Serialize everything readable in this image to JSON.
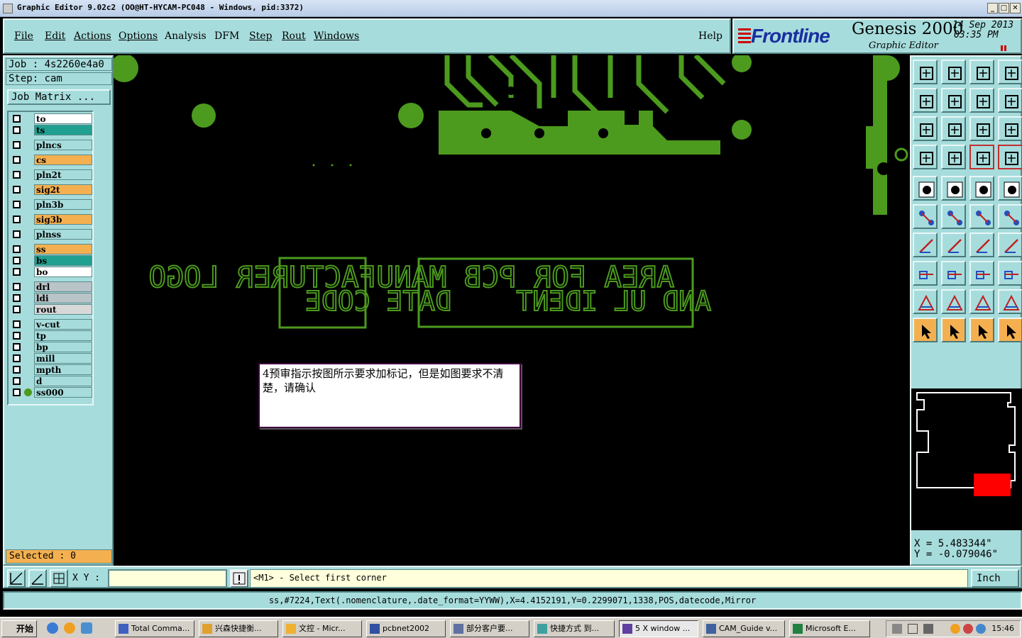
{
  "window": {
    "title": "Graphic Editor 9.02c2 (OO@HT-HYCAM-PC048 - Windows, pid:3372)"
  },
  "menu": [
    "File",
    "Edit",
    "Actions",
    "Options",
    "Analysis",
    "DFM",
    "Step",
    "Rout",
    "Windows"
  ],
  "help_label": "Help",
  "brand": {
    "logo": "Frontline",
    "product": "Genesis 2000",
    "subtitle": "Graphic Editor",
    "date": "14 Sep 2013",
    "time": "03:35 PM"
  },
  "job": {
    "job_line": "Job : 4s2260e4a0",
    "step_line": "Step: cam",
    "job_matrix": "Job Matrix ..."
  },
  "layers": [
    {
      "name": "to",
      "color": "#ffffff"
    },
    {
      "name": "ts",
      "color": "#20a090"
    },
    {
      "name": "plncs",
      "color": "#a7dcdc"
    },
    {
      "name": "cs",
      "color": "#f4b050"
    },
    {
      "name": "pln2t",
      "color": "#a7dcdc"
    },
    {
      "name": "sig2t",
      "color": "#f4b050"
    },
    {
      "name": "pln3b",
      "color": "#a7dcdc"
    },
    {
      "name": "sig3b",
      "color": "#f4b050"
    },
    {
      "name": "plnss",
      "color": "#a7dcdc"
    },
    {
      "name": "ss",
      "color": "#f4b050"
    },
    {
      "name": "bs",
      "color": "#20a090"
    },
    {
      "name": "bo",
      "color": "#ffffff"
    },
    {
      "name": "drl",
      "color": "#b8c4c8"
    },
    {
      "name": "ldi",
      "color": "#b8c4c8"
    },
    {
      "name": "rout",
      "color": "#d8d8d8"
    },
    {
      "name": "v-cut",
      "color": "#a7dcdc"
    },
    {
      "name": "tp",
      "color": "#a7dcdc"
    },
    {
      "name": "bp",
      "color": "#a7dcdc"
    },
    {
      "name": "mill",
      "color": "#a7dcdc"
    },
    {
      "name": "mpth",
      "color": "#a7dcdc"
    },
    {
      "name": "d",
      "color": "#a7dcdc"
    },
    {
      "name": "ss000",
      "color": "#a7dcdc"
    }
  ],
  "selected_label": "Selected : 0",
  "canvas": {
    "silk_color": "#4c9a1e",
    "line1": "AREA FOR PCB MANUFACTURER LOGO",
    "line2": "AND UL IDENT    DATE CODE",
    "note": "4预审指示按图所示要求加标记，但是如图要求不清楚，请确认"
  },
  "coords": {
    "x": "X = 5.483344\"",
    "y": "Y = -0.079046\""
  },
  "cmd": {
    "xy_label": "X Y :",
    "xy_value": "",
    "prompt": "<M1> - Select first corner",
    "unit": "Inch"
  },
  "status": "ss,#7224,Text(.nomenclature,.date_format=YYWW),X=4.4152191,Y=0.2299071,1338,POS,datecode,Mirror",
  "taskbar": {
    "start": "开始",
    "items": [
      "Total Comma...",
      "兴森快捷衡...",
      "文控 - Micr...",
      "pcbnet2002",
      "部分客户要...",
      "快捷方式 到...",
      "5 X window ...",
      "CAM_Guide v...",
      "Microsoft E..."
    ],
    "clock": "15:46"
  }
}
